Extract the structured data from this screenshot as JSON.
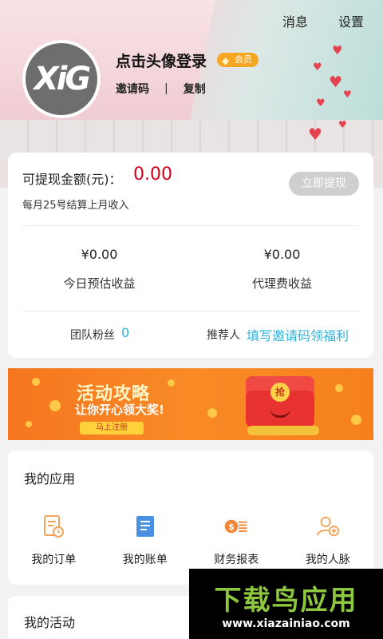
{
  "header": {
    "messages_label": "消息",
    "settings_label": "设置",
    "avatar_text": "XiG",
    "login_prompt": "点击头像登录",
    "member_badge": "会员",
    "invite_code_label": "邀请码",
    "separator": "|",
    "copy_label": "复制"
  },
  "earnings": {
    "withdrawable_label": "可提现金额(元)：",
    "withdrawable_amount": "0.00",
    "withdraw_button": "立即提现",
    "settlement_note": "每月25号结算上月收入",
    "today_estimate_value": "¥0.00",
    "today_estimate_label": "今日预估收益",
    "agency_fee_value": "¥0.00",
    "agency_fee_label": "代理费收益",
    "team_fans_label": "团队粉丝",
    "team_fans_count": "0",
    "referrer_label": "推荐人",
    "referrer_link": "填写邀请码领福利"
  },
  "banner": {
    "title": "活动攻略",
    "subtitle": "让你开心领大奖!",
    "cta": "马上注册",
    "envelope_char": "抢"
  },
  "apps": {
    "title": "我的应用",
    "items": [
      {
        "label": "我的订单",
        "icon": "order-icon"
      },
      {
        "label": "我的账单",
        "icon": "bill-icon"
      },
      {
        "label": "财务报表",
        "icon": "finance-report-icon"
      },
      {
        "label": "我的人脉",
        "icon": "contacts-icon"
      }
    ]
  },
  "activity": {
    "title": "我的活动"
  },
  "watermark": {
    "main": "下载鸟应用",
    "sub": "www.xiazainiao.com"
  },
  "colors": {
    "accent_red": "#d0021b",
    "link_blue": "#2fb3d9",
    "badge_orange": "#f5a623",
    "banner_orange": "#f98a26",
    "icon_orange": "#f0a35a"
  }
}
